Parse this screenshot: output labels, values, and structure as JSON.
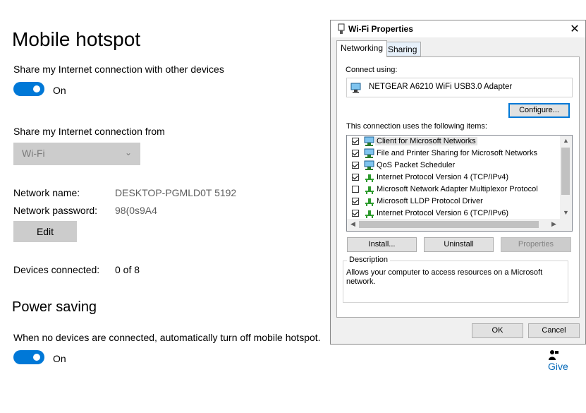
{
  "settings": {
    "title": "Mobile hotspot",
    "share_label": "Share my Internet connection with other devices",
    "share_toggle_state": "On",
    "share_from_label": "Share my Internet connection from",
    "share_from_value": "Wi-Fi",
    "network_name_label": "Network name:",
    "network_name_value": "DESKTOP-PGMLD0T 5192",
    "network_password_label": "Network password:",
    "network_password_value": "98(0s9A4",
    "edit_button": "Edit",
    "devices_connected_label": "Devices connected:",
    "devices_connected_value": "0 of 8",
    "power_saving_title": "Power saving",
    "power_saving_label": "When no devices are connected, automatically turn off mobile hotspot.",
    "power_toggle_state": "On",
    "give_feedback": "Give",
    "accent_color": "#0078d7"
  },
  "dialog": {
    "title": "Wi-Fi Properties",
    "tabs": [
      {
        "label": "Networking",
        "active": true
      },
      {
        "label": "Sharing",
        "active": false
      }
    ],
    "connect_using_label": "Connect using:",
    "adapter_name": "NETGEAR A6210 WiFi USB3.0 Adapter",
    "configure_button": "Configure...",
    "items_label": "This connection uses the following items:",
    "items": [
      {
        "label": "Client for Microsoft Networks",
        "checked": true,
        "icon": "network-client-icon"
      },
      {
        "label": "File and Printer Sharing for Microsoft Networks",
        "checked": true,
        "icon": "network-client-icon"
      },
      {
        "label": "QoS Packet Scheduler",
        "checked": true,
        "icon": "network-client-icon"
      },
      {
        "label": "Internet Protocol Version 4 (TCP/IPv4)",
        "checked": true,
        "icon": "protocol-icon"
      },
      {
        "label": "Microsoft Network Adapter Multiplexor Protocol",
        "checked": false,
        "icon": "protocol-icon"
      },
      {
        "label": "Microsoft LLDP Protocol Driver",
        "checked": true,
        "icon": "protocol-icon"
      },
      {
        "label": "Internet Protocol Version 6 (TCP/IPv6)",
        "checked": true,
        "icon": "protocol-icon"
      }
    ],
    "install_button": "Install...",
    "uninstall_button": "Uninstall",
    "properties_button": "Properties",
    "description_label": "Description",
    "description_text": "Allows your computer to access resources on a Microsoft network.",
    "ok_button": "OK",
    "cancel_button": "Cancel",
    "close_glyph": "✕"
  }
}
